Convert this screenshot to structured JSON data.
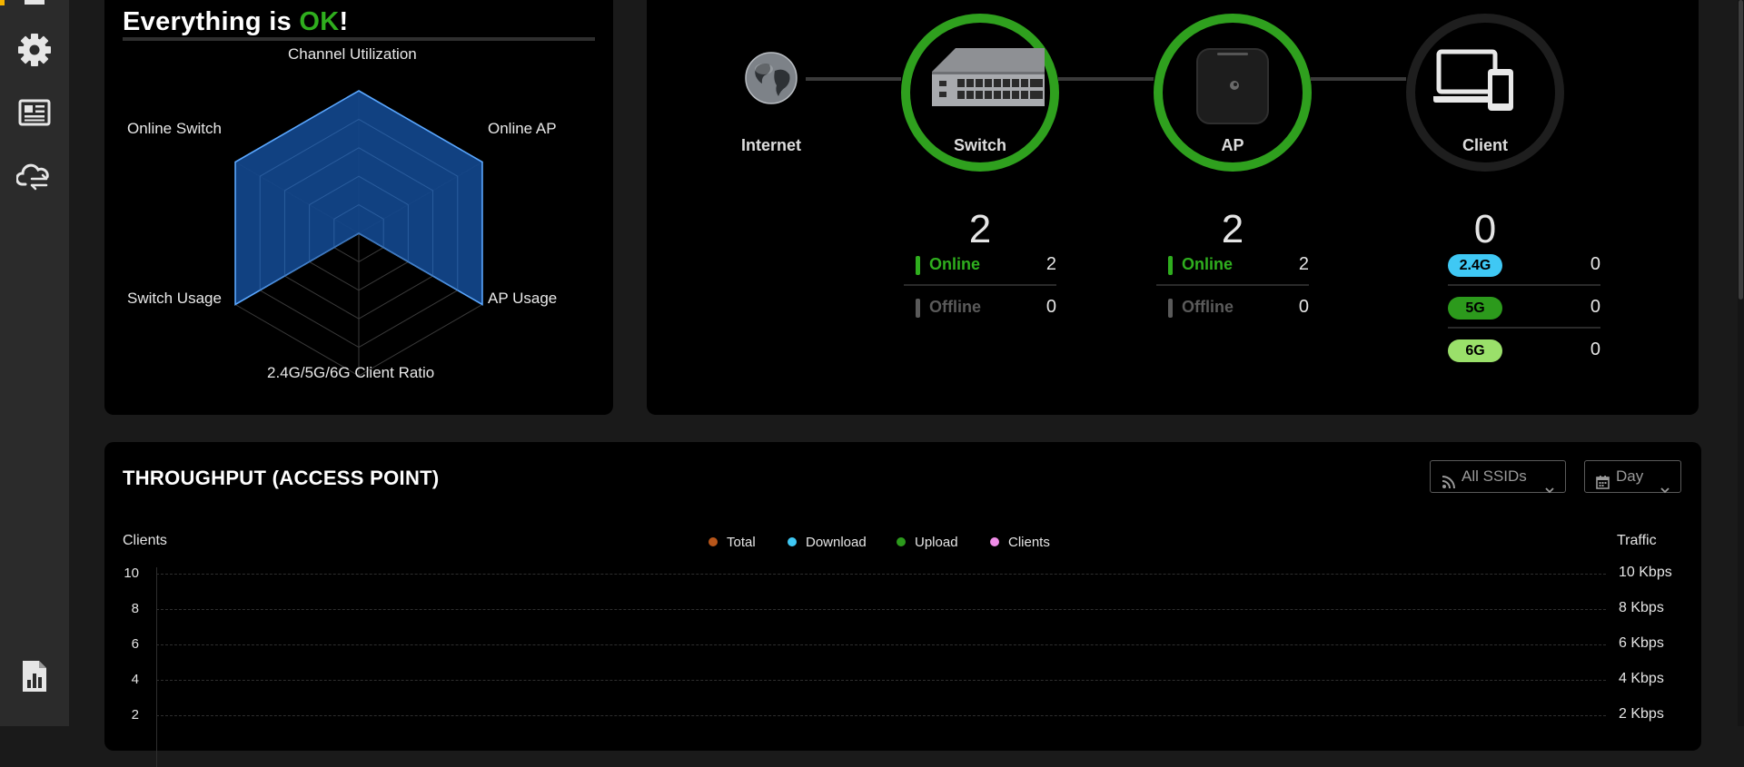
{
  "sidebar": {
    "items": [
      {
        "icon": "gear-icon"
      },
      {
        "icon": "newspaper-icon"
      },
      {
        "icon": "cloud-sync-icon"
      },
      {
        "icon": "report-chart-icon"
      }
    ]
  },
  "health": {
    "title_prefix": "Everything is ",
    "title_status": "OK",
    "title_suffix": "!",
    "status_color": "#2fae1e",
    "radar_labels": [
      "Channel Utilization",
      "Online AP",
      "AP Usage",
      "2.4G/5G/6G Client Ratio",
      "Switch Usage",
      "Online Switch"
    ],
    "radar_values": [
      1.0,
      1.0,
      1.0,
      0.0,
      1.0,
      1.0
    ],
    "fill_color": "#12478c",
    "stroke_color": "#5aa7ff"
  },
  "topology": {
    "internet_label": "Internet",
    "switch": {
      "label": "Switch",
      "count": "2",
      "online_label": "Online",
      "online": "2",
      "offline_label": "Offline",
      "offline": "0"
    },
    "ap": {
      "label": "AP",
      "count": "2",
      "online_label": "Online",
      "online": "2",
      "offline_label": "Offline",
      "offline": "0"
    },
    "client": {
      "label": "Client",
      "count": "0",
      "bands": [
        {
          "label": "2.4G",
          "value": "0",
          "color": "#3fc8f4"
        },
        {
          "label": "5G",
          "value": "0",
          "color": "#2c9a1c"
        },
        {
          "label": "6G",
          "value": "0",
          "color": "#9ae06a"
        }
      ]
    },
    "online_color": "#2fae1e",
    "offline_color": "#5a5a5a"
  },
  "throughput": {
    "title": "THROUGHPUT (ACCESS POINT)",
    "ssid_select": "All SSIDs",
    "range_select": "Day",
    "left_axis_title": "Clients",
    "right_axis_title": "Traffic",
    "legend": [
      {
        "label": "Total",
        "color": "#b8561a"
      },
      {
        "label": "Download",
        "color": "#3fc8f4"
      },
      {
        "label": "Upload",
        "color": "#2c9a1c"
      },
      {
        "label": "Clients",
        "color": "#f08de8"
      }
    ],
    "left_ticks": [
      "10",
      "8",
      "6",
      "4",
      "2"
    ],
    "right_ticks": [
      "10 Kbps",
      "8 Kbps",
      "6 Kbps",
      "4 Kbps",
      "2 Kbps"
    ]
  }
}
